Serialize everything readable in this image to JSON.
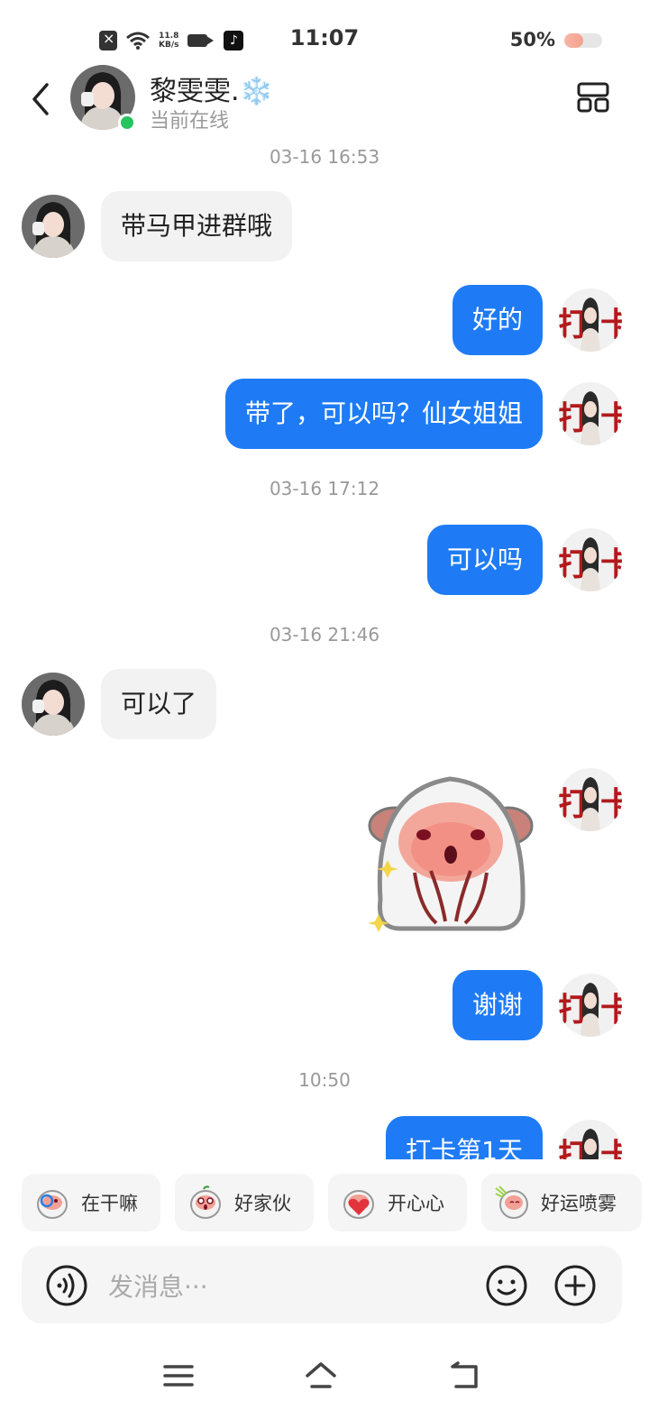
{
  "status_bar": {
    "speed_value": "11.8",
    "speed_unit": "KB/s",
    "time": "11:07",
    "battery_pct": "50%",
    "battery_level": 0.5
  },
  "header": {
    "contact_name": "黎雯雯.❄️",
    "status": "当前在线"
  },
  "messages": [
    {
      "type": "timestamp",
      "text": "03-16 16:53"
    },
    {
      "type": "text",
      "from": "contact",
      "text": "带马甲进群哦"
    },
    {
      "type": "text",
      "from": "me",
      "text": "好的"
    },
    {
      "type": "text",
      "from": "me",
      "text": "带了，可以吗？仙女姐姐"
    },
    {
      "type": "timestamp",
      "text": "03-16 17:12"
    },
    {
      "type": "text",
      "from": "me",
      "text": "可以吗"
    },
    {
      "type": "timestamp",
      "text": "03-16 21:46"
    },
    {
      "type": "text",
      "from": "contact",
      "text": "可以了"
    },
    {
      "type": "sticker",
      "from": "me",
      "sticker": "crying-peach-sticker"
    },
    {
      "type": "text",
      "from": "me",
      "text": "谢谢"
    },
    {
      "type": "timestamp",
      "text": "10:50"
    },
    {
      "type": "text",
      "from": "me",
      "text": "打卡第1天"
    }
  ],
  "quick_replies": [
    {
      "label": "在干嘛",
      "icon": "peach-magnifier-icon"
    },
    {
      "label": "好家伙",
      "icon": "peach-surprised-icon"
    },
    {
      "label": "开心心",
      "icon": "peach-heart-icon"
    },
    {
      "label": "好运喷雾",
      "icon": "peach-spray-icon"
    }
  ],
  "input": {
    "placeholder": "发消息···"
  },
  "colors": {
    "outgoing_bubble": "#1e7bf5",
    "incoming_bubble": "#f2f2f2",
    "online": "#22c55e"
  }
}
